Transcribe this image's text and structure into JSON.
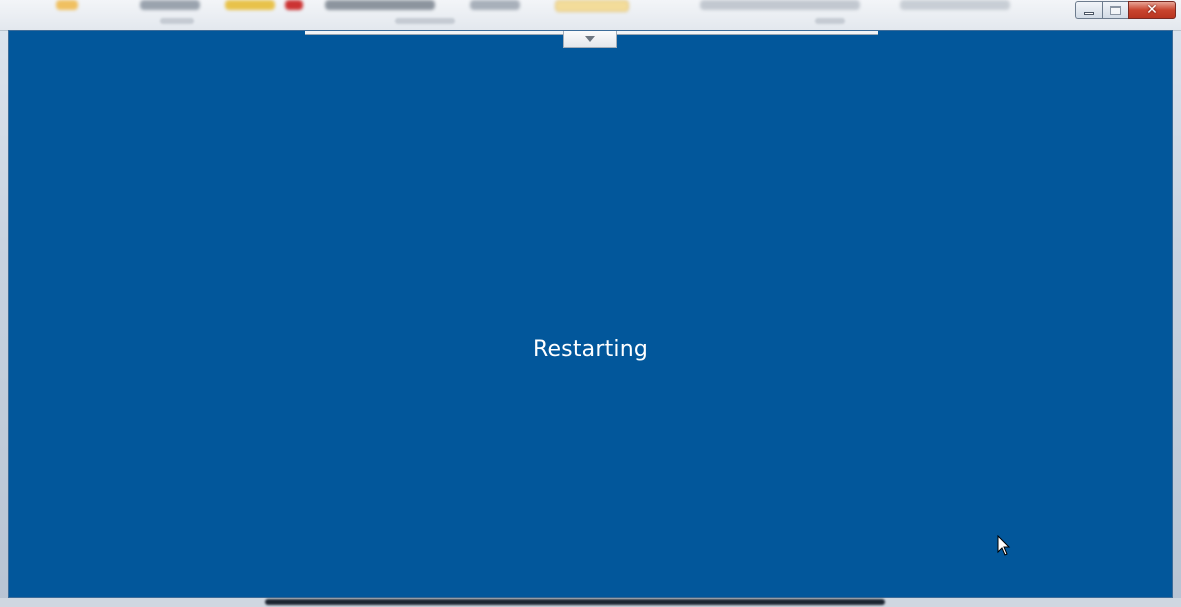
{
  "window": {
    "caption": {
      "minimize_icon": "minimize-icon",
      "maximize_icon": "maximize-icon",
      "close_label": "✕"
    }
  },
  "session": {
    "background_color": "#02579b",
    "status_text": "Restarting",
    "connection_bar": {
      "toggle_icon": "chevron-down-icon"
    }
  }
}
